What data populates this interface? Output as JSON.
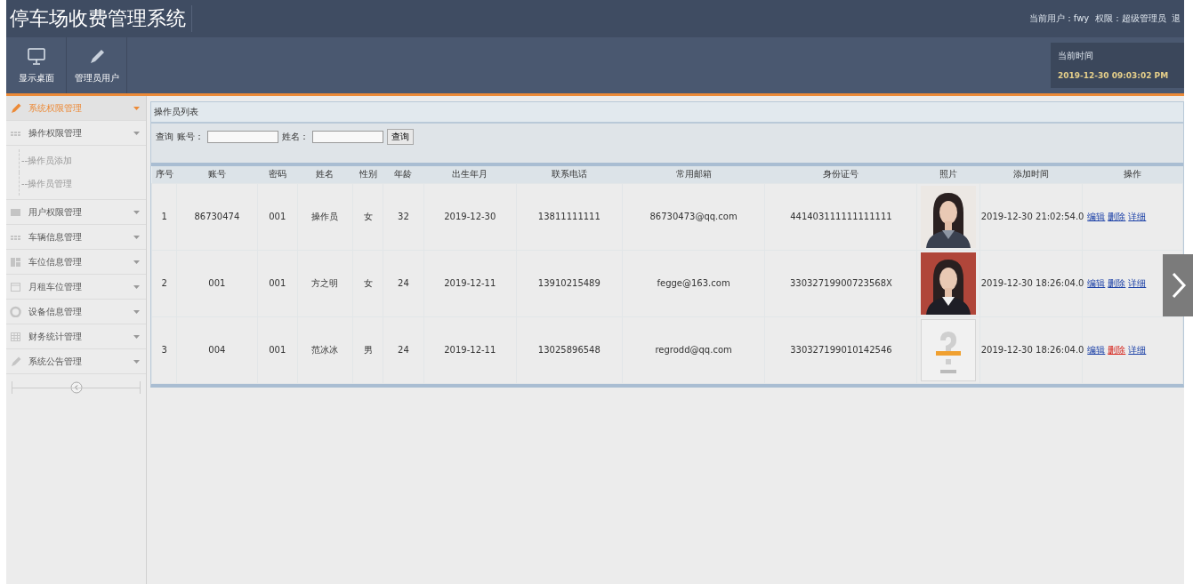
{
  "header": {
    "title": "停车场收费管理系统",
    "user_info": "当前用户：fwy  权限：超级管理员  退"
  },
  "toolbar": [
    {
      "label": "显示桌面"
    },
    {
      "label": "管理员用户"
    }
  ],
  "clock": {
    "label": "当前时间",
    "time": "2019-12-30 09:03:02 PM"
  },
  "sidebar": {
    "items": [
      {
        "label": "系统权限管理",
        "selected": true
      },
      {
        "label": "操作权限管理",
        "selected": false,
        "children": [
          {
            "label": "--操作员添加"
          },
          {
            "label": "--操作员管理"
          }
        ]
      },
      {
        "label": "用户权限管理",
        "selected": false
      },
      {
        "label": "车辆信息管理",
        "selected": false
      },
      {
        "label": "车位信息管理",
        "selected": false
      },
      {
        "label": "月租车位管理",
        "selected": false
      },
      {
        "label": "设备信息管理",
        "selected": false
      },
      {
        "label": "财务统计管理",
        "selected": false
      },
      {
        "label": "系统公告管理",
        "selected": false
      }
    ]
  },
  "panel": {
    "title": "操作员列表",
    "search": {
      "label": "查询",
      "fields": [
        {
          "label": "账号："
        },
        {
          "label": "姓名："
        }
      ],
      "button": "查询"
    }
  },
  "table": {
    "columns": [
      "序号",
      "账号",
      "密码",
      "姓名",
      "性别",
      "年龄",
      "出生年月",
      "联系电话",
      "常用邮箱",
      "身份证号",
      "照片",
      "添加时间",
      "操作"
    ],
    "rows": [
      {
        "cells": [
          "1",
          "86730474",
          "001",
          "操作员",
          "女",
          "32",
          "2019-12-30",
          "13811111111",
          "86730473@qq.com",
          "441403111111111111"
        ],
        "added": "2019-12-30 21:02:54.0",
        "actions": [
          {
            "label": "编辑",
            "hovered": false
          },
          {
            "label": "删除",
            "hovered": false
          },
          {
            "label": "详细",
            "hovered": false
          }
        ]
      },
      {
        "cells": [
          "2",
          "001",
          "001",
          "方之明",
          "女",
          "24",
          "2019-12-11",
          "13910215489",
          "fegge@163.com",
          "33032719900723568X"
        ],
        "added": "2019-12-30 18:26:04.0",
        "actions": [
          {
            "label": "编辑",
            "hovered": false
          },
          {
            "label": "删除",
            "hovered": false
          },
          {
            "label": "详细",
            "hovered": false
          }
        ]
      },
      {
        "cells": [
          "3",
          "004",
          "001",
          "范冰冰",
          "男",
          "24",
          "2019-12-11",
          "13025896548",
          "regrodd@qq.com",
          "330327199010142546"
        ],
        "photo": {
          "kind": "none"
        },
        "added": "2019-12-30 18:26:04.0",
        "actions": [
          {
            "label": "编辑",
            "hovered": false
          },
          {
            "label": "删除",
            "hovered": true
          },
          {
            "label": "详细",
            "hovered": false
          }
        ]
      }
    ]
  }
}
